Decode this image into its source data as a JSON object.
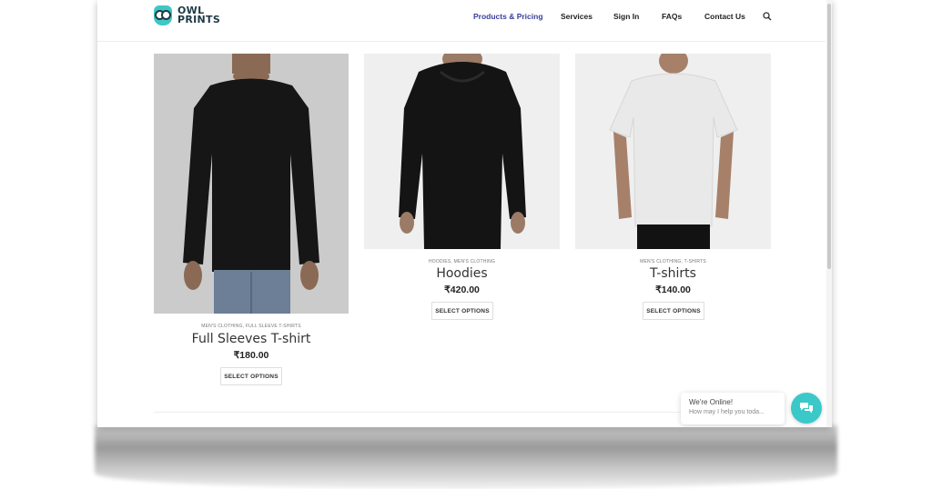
{
  "brand": {
    "line1": "OWL",
    "line2": "PRINTS"
  },
  "nav": {
    "products": "Products & Pricing",
    "services": "Services",
    "signin": "Sign In",
    "faqs": "FAQs",
    "contact": "Contact Us"
  },
  "icons": {
    "search": "search-icon",
    "chat": "chat-icon",
    "logo": "owl-logo-icon"
  },
  "colors": {
    "accent": "#3a3f9a",
    "teal": "#3bc8c9",
    "text": "#222222"
  },
  "products": [
    {
      "categories": "MEN'S CLOTHING, FULL SLEEVE T-SHIRTS",
      "name": "Full Sleeves T-shirt",
      "price": "₹180.00",
      "button": "SELECT OPTIONS"
    },
    {
      "categories": "HOODIES, MEN'S CLOTHING",
      "name": "Hoodies",
      "price": "₹420.00",
      "button": "SELECT OPTIONS"
    },
    {
      "categories": "MEN'S CLOTHING, T-SHIRTS",
      "name": "T-shirts",
      "price": "₹140.00",
      "button": "SELECT OPTIONS"
    }
  ],
  "chat": {
    "title": "We're Online!",
    "subtitle": "How may I help you toda..."
  }
}
